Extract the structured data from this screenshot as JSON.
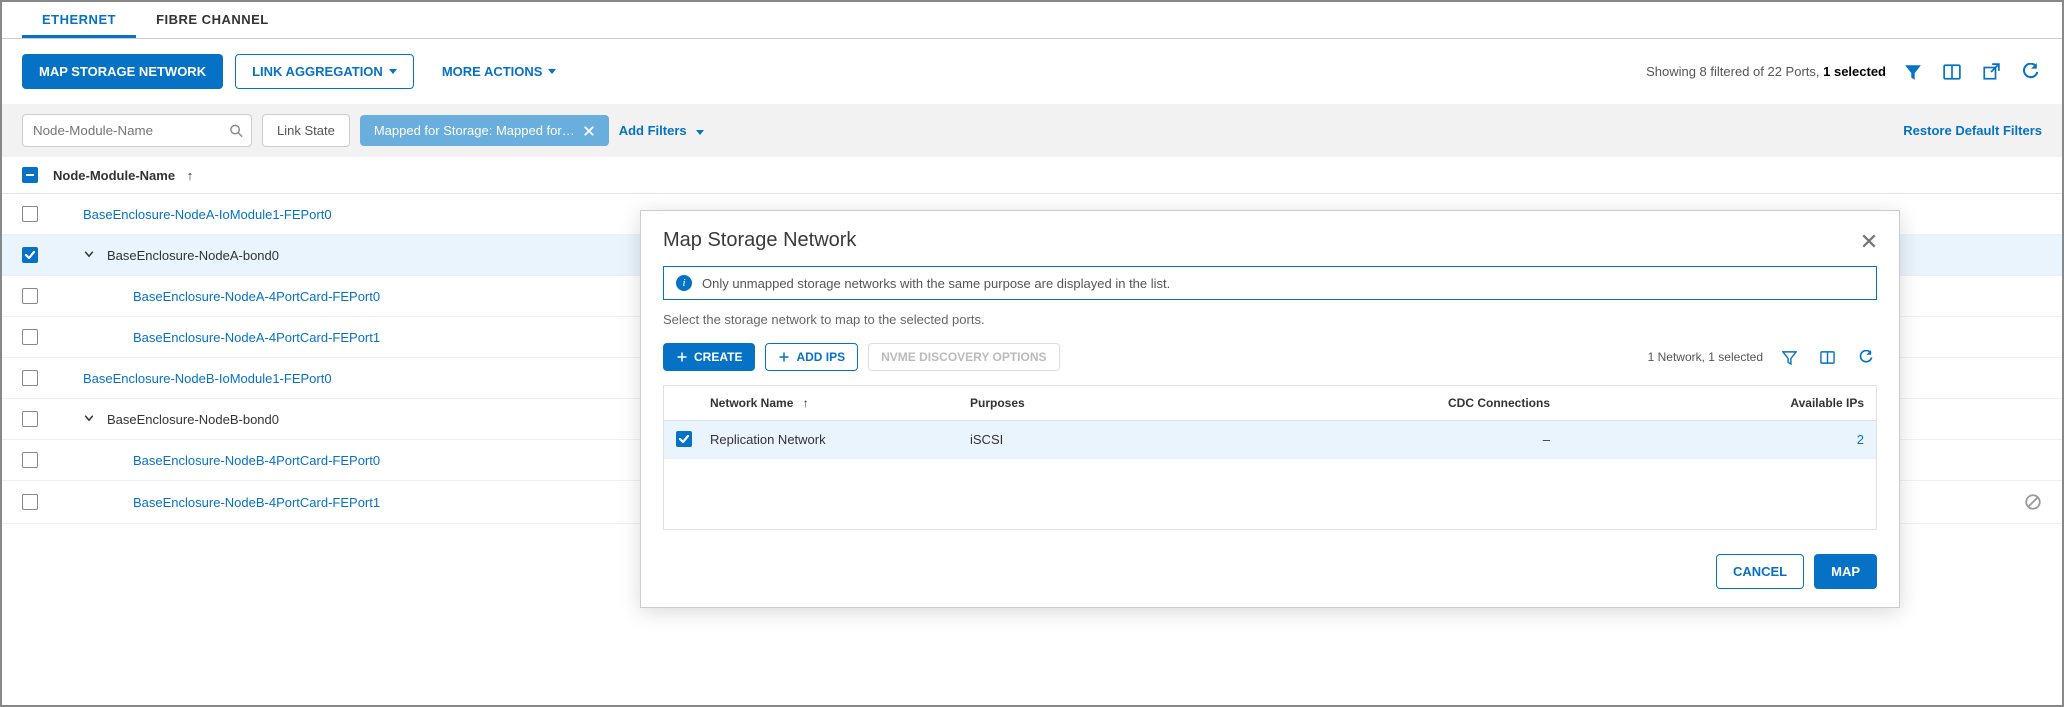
{
  "tabs": {
    "ethernet": "ETHERNET",
    "fibre": "FIBRE CHANNEL"
  },
  "toolbar": {
    "map_storage": "MAP STORAGE NETWORK",
    "link_aggregation": "LINK AGGREGATION",
    "more_actions": "MORE ACTIONS",
    "status_prefix": "Showing 8 filtered of 22 Ports, ",
    "status_strong": "1 selected"
  },
  "filter": {
    "search_placeholder": "Node-Module-Name",
    "link_state": "Link State",
    "mapped_chip": "Mapped for Storage: Mapped for…",
    "add_filters": "Add Filters",
    "restore": "Restore Default Filters"
  },
  "columns": {
    "name": "Node-Module-Name"
  },
  "rows": [
    {
      "label": "BaseEnclosure-NodeA-IoModule1-FEPort0",
      "link": true,
      "checked": false,
      "expandable": false,
      "indent": 1
    },
    {
      "label": "BaseEnclosure-NodeA-bond0",
      "link": false,
      "checked": true,
      "expandable": true,
      "indent": 1,
      "selected": true
    },
    {
      "label": "BaseEnclosure-NodeA-4PortCard-FEPort0",
      "link": true,
      "checked": false,
      "expandable": false,
      "indent": 2
    },
    {
      "label": "BaseEnclosure-NodeA-4PortCard-FEPort1",
      "link": true,
      "checked": false,
      "expandable": false,
      "indent": 2
    },
    {
      "label": "BaseEnclosure-NodeB-IoModule1-FEPort0",
      "link": true,
      "checked": false,
      "expandable": false,
      "indent": 1
    },
    {
      "label": "BaseEnclosure-NodeB-bond0",
      "link": false,
      "checked": false,
      "expandable": true,
      "indent": 1
    },
    {
      "label": "BaseEnclosure-NodeB-4PortCard-FEPort0",
      "link": true,
      "checked": false,
      "expandable": false,
      "indent": 2
    },
    {
      "label": "BaseEnclosure-NodeB-4PortCard-FEPort1",
      "link": true,
      "checked": false,
      "expandable": false,
      "indent": 2,
      "status_icons": true
    }
  ],
  "modal": {
    "title": "Map Storage Network",
    "info": "Only unmapped storage networks with the same purpose are displayed in the list.",
    "subtitle": "Select the storage network to map to the selected ports.",
    "create": "CREATE",
    "add_ips": "ADD IPS",
    "nvme": "NVME DISCOVERY OPTIONS",
    "count": "1 Network, 1 selected",
    "cols": {
      "name": "Network Name",
      "purposes": "Purposes",
      "cdc": "CDC Connections",
      "ips": "Available IPs"
    },
    "row": {
      "name": "Replication Network",
      "purposes": "iSCSI",
      "cdc": "–",
      "ips": "2"
    },
    "cancel": "CANCEL",
    "map": "MAP"
  }
}
